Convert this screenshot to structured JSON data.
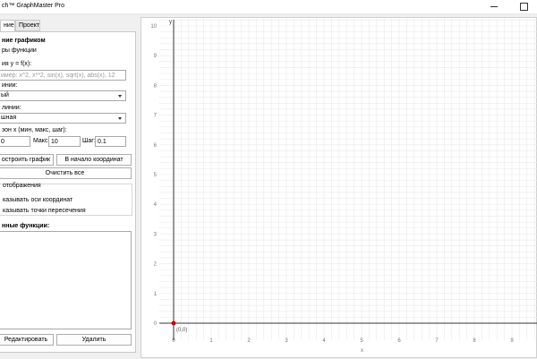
{
  "window": {
    "title": "ch™ GraphMaster Pro"
  },
  "tabs": [
    {
      "label": "ние",
      "active": true
    },
    {
      "label": "Проект",
      "active": false
    }
  ],
  "left_panel": {
    "section_title": "ние графиком",
    "function_params_title": "ры функции",
    "function_label": "ия y = f(x):",
    "function_placeholder": "имер: x^2, x**2, sin(x), sqrt(x), abs(x), 12",
    "line_color_label": "инии:",
    "line_color_value": "ый",
    "line_style_label": "линии:",
    "line_style_value": "шная",
    "range_label": "зон x (мин, макс, шаг):",
    "range_min": "0",
    "range_max_label": "Макс:",
    "range_max": "10",
    "range_step_label": "Шаг:",
    "range_step": "0.1",
    "plot_button": "остроить график",
    "origin_button": "В начало координат",
    "clear_all_button": "Очистить все",
    "display_group_title": "отображения",
    "show_axes": "казывать оси координат",
    "show_intersections": "казывать точки пересечения",
    "saved_functions_label": "нные функции:",
    "edit_button": "Редактировать",
    "delete_button": "Удалить"
  },
  "graph": {
    "x_axis_label": "x",
    "y_axis_label": "y",
    "origin_label": "(0,0)",
    "origin_color": "#cc0000",
    "axis_color": "#333333",
    "grid_color": "#e9e9e9",
    "x_ticks": [
      "0",
      "1",
      "2",
      "3",
      "4",
      "5",
      "6",
      "7",
      "8",
      "9"
    ],
    "y_ticks": [
      "0",
      "1",
      "2",
      "3",
      "4",
      "5",
      "6",
      "7",
      "8",
      "9",
      "10"
    ]
  }
}
